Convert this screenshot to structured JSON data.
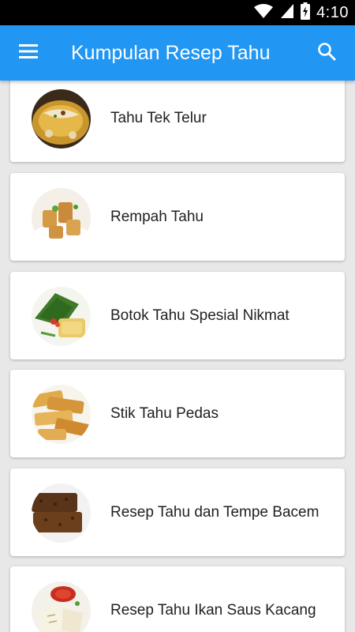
{
  "status_bar": {
    "time": "4:10",
    "icons": [
      "wifi-icon",
      "cellular-signal-icon",
      "battery-charging-icon"
    ]
  },
  "app_bar": {
    "title": "Kumpulan Resep Tahu",
    "menu_icon": "hamburger-menu-icon",
    "search_icon": "search-icon",
    "color": "#2196f3"
  },
  "recipes": [
    {
      "title": "Tahu Tek Telur",
      "image": "tahu-tek-telur-photo"
    },
    {
      "title": "Rempah Tahu",
      "image": "rempah-tahu-photo"
    },
    {
      "title": "Botok Tahu Spesial Nikmat",
      "image": "botok-tahu-photo"
    },
    {
      "title": "Stik Tahu Pedas",
      "image": "stik-tahu-photo"
    },
    {
      "title": "Resep Tahu dan Tempe Bacem",
      "image": "tahu-tempe-bacem-photo"
    },
    {
      "title": "Resep Tahu Ikan Saus Kacang",
      "image": "tahu-ikan-photo"
    }
  ]
}
